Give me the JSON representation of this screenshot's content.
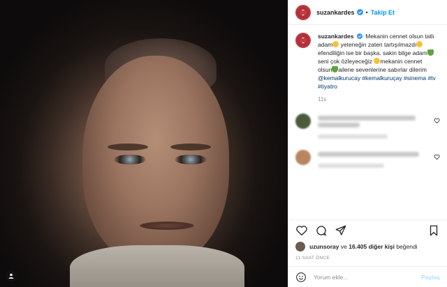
{
  "header": {
    "username": "suzankardes",
    "follow_label": "Takip Et",
    "separator": "•"
  },
  "caption": {
    "username": "suzankardes",
    "segments": [
      "Mekanin cennet olsun tatlı adam",
      " yeteneğin zaten tartışılmazdı",
      "efendiliğin ise bir başka. sakin bilge adam",
      " seni çok özleyeceğiz ",
      "mekanin cennet olsun",
      "ailene sevenlerine sabırlar dilerim"
    ],
    "tags": "@kemalkurucay #kemalkuruçay #sinema #tv #tiyatro",
    "time": "11s"
  },
  "comments": [
    {
      "avatar_color": "#4a5a3a"
    },
    {
      "avatar_color": "#b88560"
    }
  ],
  "likes": {
    "user": "uzunsoray",
    "conjunction": "ve",
    "others": "16.405 diğer kişi",
    "verb": "beğendi"
  },
  "posted_ago": "11 SAAT ÖNCE",
  "composer": {
    "placeholder": "Yorum ekle...",
    "post_label": "Paylaş"
  },
  "colors": {
    "accent_blue": "#0095f6",
    "verified_blue": "#3897f0",
    "link_blue": "#00376b",
    "muted": "#8e8e8e"
  },
  "icons": [
    "verified-icon",
    "heart-icon",
    "comment-icon",
    "share-icon",
    "bookmark-icon",
    "emoji-icon",
    "multi-image-icon"
  ]
}
